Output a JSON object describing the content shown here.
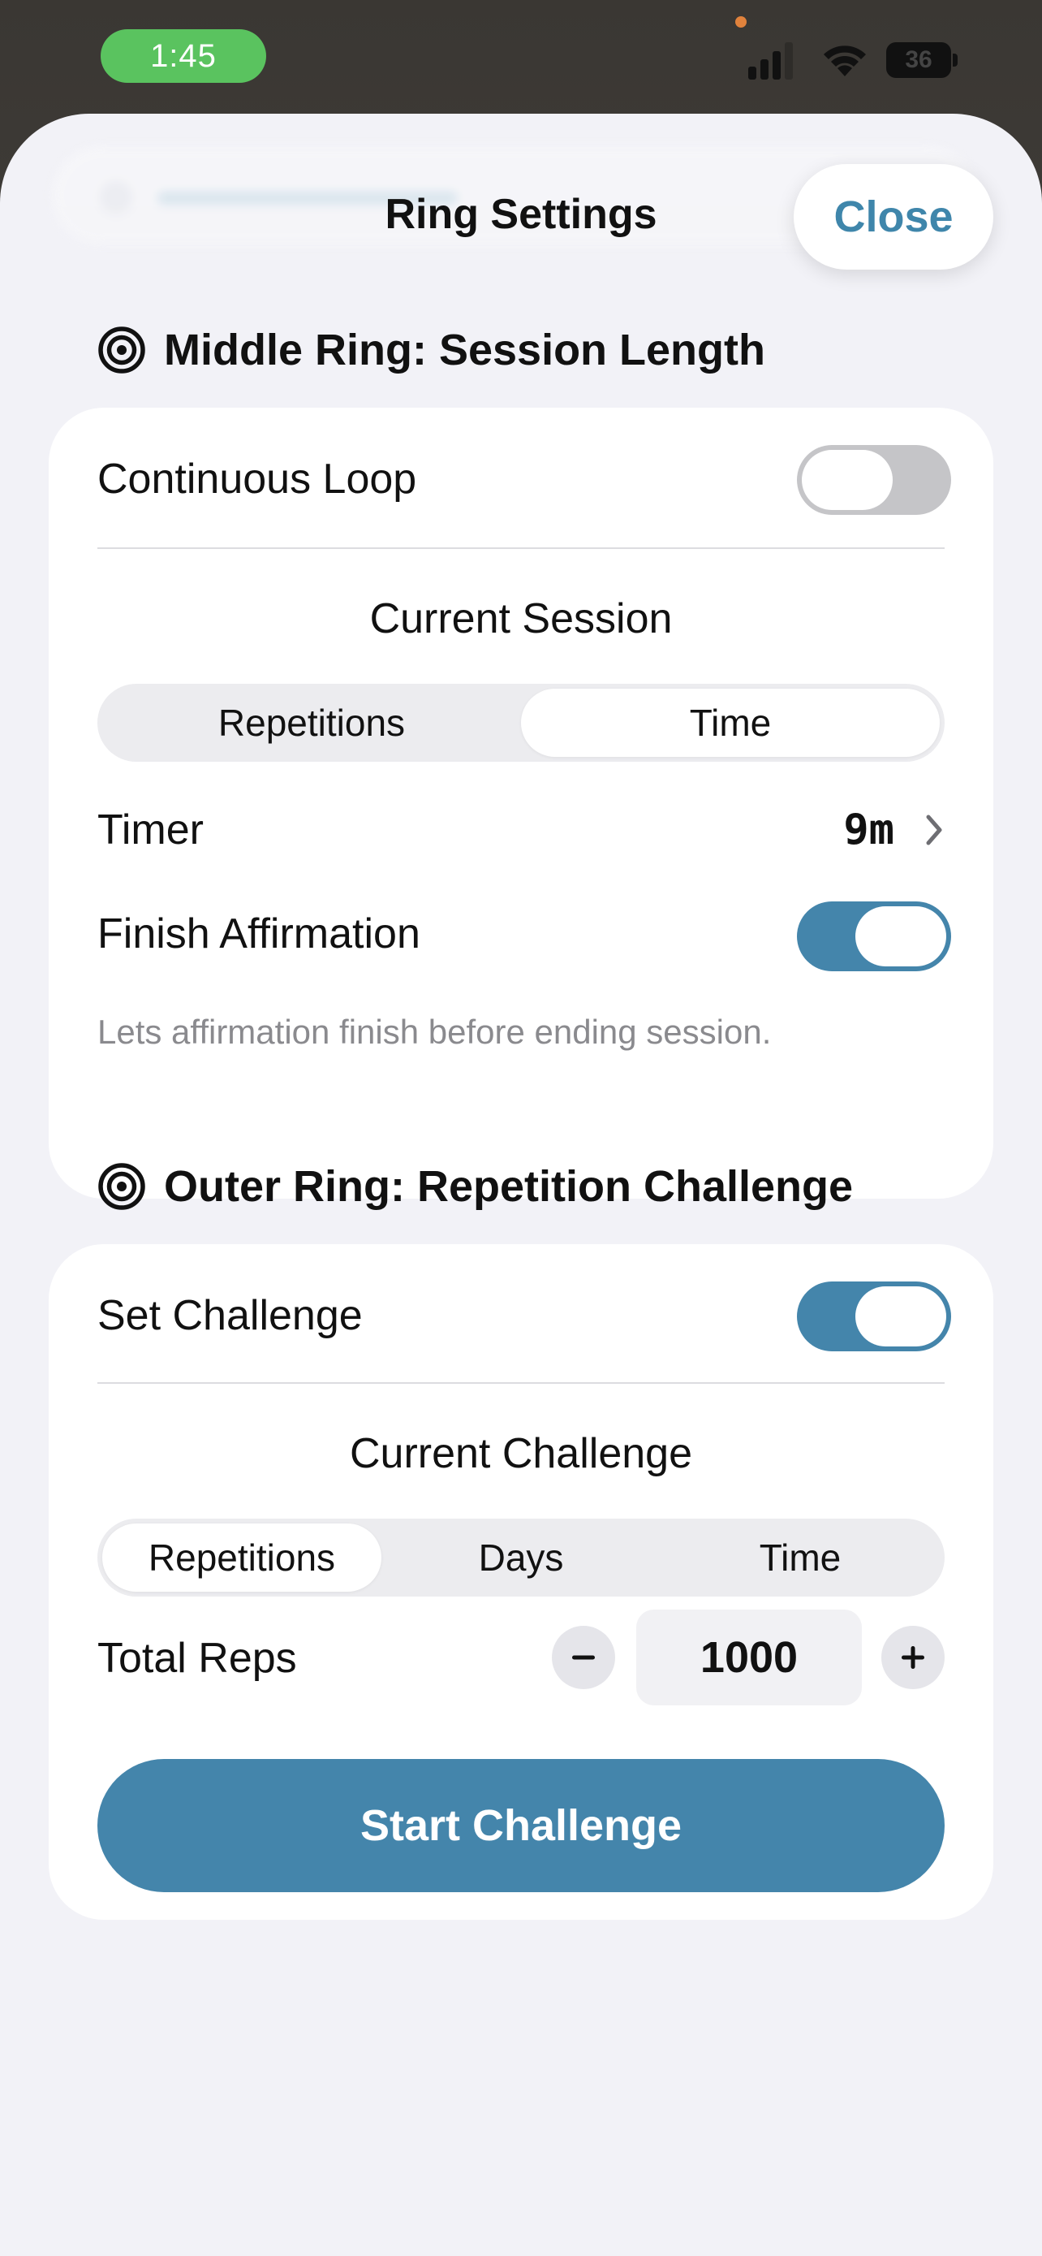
{
  "status_bar": {
    "time": "1:45",
    "battery_level": "36",
    "pill_color": "#5ac35f",
    "privacy_dot_color": "#e0823c"
  },
  "sheet": {
    "title": "Ring Settings",
    "close_label": "Close"
  },
  "middle_ring": {
    "header": "Middle Ring: Session Length",
    "header_icon": "target-icon",
    "continuous_loop_label": "Continuous Loop",
    "continuous_loop_on": false,
    "current_session_label": "Current Session",
    "segments": [
      {
        "label": "Repetitions",
        "selected": false
      },
      {
        "label": "Time",
        "selected": true
      }
    ],
    "timer_label": "Timer",
    "timer_value": "9m",
    "finish_affirmation_label": "Finish Affirmation",
    "finish_affirmation_on": true,
    "footnote": "Lets affirmation finish before ending session."
  },
  "outer_ring": {
    "header": "Outer Ring: Repetition Challenge",
    "header_icon": "target-icon",
    "set_challenge_label": "Set Challenge",
    "set_challenge_on": true,
    "current_challenge_label": "Current Challenge",
    "segments": [
      {
        "label": "Repetitions",
        "selected": true
      },
      {
        "label": "Days",
        "selected": false
      },
      {
        "label": "Time",
        "selected": false
      }
    ],
    "total_reps_label": "Total Reps",
    "total_reps_value": "1000",
    "decrement_symbol": "−",
    "increment_symbol": "+",
    "start_button_label": "Start Challenge"
  },
  "colors": {
    "accent": "#4485ab",
    "close_text": "#3f86ab",
    "sheet_background": "#f2f2f7",
    "toggle_off": "#c5c5c8"
  }
}
